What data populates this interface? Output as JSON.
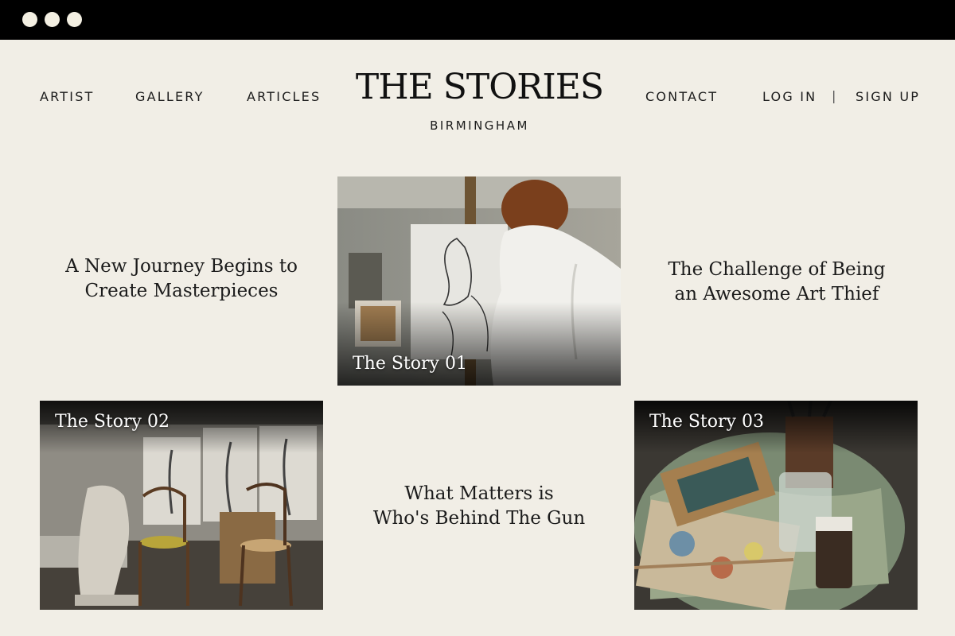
{
  "nav": {
    "artist": "ARTIST",
    "gallery": "GALLERY",
    "articles": "ARTICLES",
    "contact": "CONTACT",
    "login": "LOG IN",
    "separator": "|",
    "signup": "SIGN UP"
  },
  "brand": {
    "title": "THE STORIES",
    "subtitle": "BIRMINGHAM"
  },
  "stories": [
    {
      "label": "The Story 01",
      "headline": [
        "A New Journey Begins to",
        "Create Masterpieces"
      ]
    },
    {
      "label": "The Story 02",
      "headline": [
        "The Challenge of Being",
        "an Awesome Art Thief"
      ]
    },
    {
      "label": "The Story 03",
      "headline": [
        "What Matters is",
        "Who's Behind The Gun"
      ]
    }
  ],
  "colors": {
    "background": "#f1eee6",
    "titlebar": "#000000",
    "text": "#1f1f1f"
  }
}
